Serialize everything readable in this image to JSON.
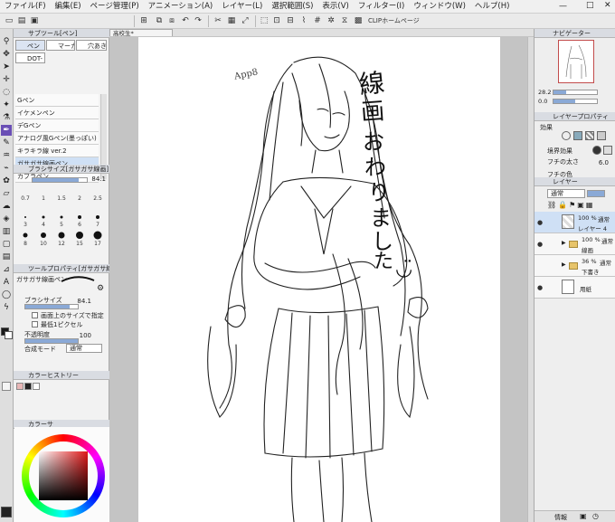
{
  "menu": [
    "ファイル(F)",
    "編集(E)",
    "ページ管理(P)",
    "アニメーション(A)",
    "レイヤー(L)",
    "選択範囲(S)",
    "表示(V)",
    "フィルター(I)",
    "ウィンドウ(W)",
    "ヘルプ(H)"
  ],
  "toolbar": {
    "clip_label": "CLIPホームページ"
  },
  "subtool": {
    "title": "サブツール[ペン]",
    "tabs": [
      "ペン",
      "マーカ",
      "穴あき",
      "DOT-"
    ],
    "brushes": [
      "Gペン",
      "イケメンペン",
      "デGペン",
      "アナログ風Gペン(墨っぽい)",
      "キラキラ線 ver.2",
      "ガサガサ線画ペン",
      "カブラペン"
    ]
  },
  "brush_size_panel": {
    "title": "ブラシサイズ[ガサガサ線画]",
    "value": "84.1",
    "sizes": [
      "0.7",
      "1",
      "1.5",
      "2",
      "2.5",
      "3",
      "4",
      "5",
      "6",
      "7",
      "8",
      "10",
      "12",
      "15",
      "17"
    ]
  },
  "tool_property": {
    "title": "ツールプロパティ[ガサガサ線画]",
    "brush_name": "ガサガサ線画ペン",
    "size_label": "ブラシサイズ",
    "size_value": "84.1",
    "opt1": "画面上のサイズで指定",
    "opt2": "最低1ピクセル",
    "opacity_label": "不透明度",
    "opacity_value": "100",
    "blend_label": "合成モード",
    "blend_value": "通常"
  },
  "color_history": {
    "title": "カラーヒストリー"
  },
  "color_circle": {
    "title": "カラーサ"
  },
  "canvas": {
    "tab_title": "高校生*",
    "text_app": "App8",
    "text_message": [
      "線",
      "画",
      "お",
      "わ",
      "り",
      "ま",
      "し",
      "た",
      "◡̈"
    ]
  },
  "navigator": {
    "title": "ナビゲーター",
    "zoom": "28.2",
    "angle": "0.0"
  },
  "layer_property": {
    "title": "レイヤープロパティ",
    "effect_label": "効果",
    "border_label": "境界効果",
    "edge_label": "フチの太さ",
    "edge_value": "6.0",
    "edge_color_label": "フチの色"
  },
  "layers": {
    "title": "レイヤー",
    "blend_mode": "通常",
    "opacity": "100",
    "rows": [
      {
        "opacity": "100 %",
        "mode": "通常",
        "name": "レイヤー 4"
      },
      {
        "opacity": "100 %",
        "mode": "通常",
        "name": "線画"
      },
      {
        "opacity": "36 %",
        "mode": "通常",
        "name": "下書き"
      },
      {
        "opacity": "",
        "mode": "",
        "name": "用紙"
      }
    ]
  },
  "status": {
    "info_label": "情報"
  },
  "colors": {
    "selected_tool": "#6a4fb5",
    "main_color": "#1a1a1a",
    "sub_color": "#ffffff",
    "layer_selected": "#cfe0f5"
  }
}
